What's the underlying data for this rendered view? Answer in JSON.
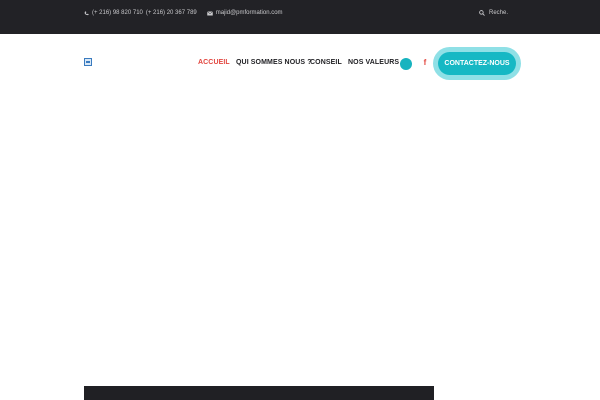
{
  "topbar": {
    "phone_1": "(+ 216) 98 820 710",
    "phone_2": "(+ 216) 20 367 789",
    "email": "majid@pmformation.com",
    "search_placeholder": "Reche.",
    "phone_icon": "phone-icon",
    "email_icon": "envelope-icon",
    "search_icon": "search-icon"
  },
  "nav": {
    "items": [
      {
        "label": "ACCUEIL",
        "active": true
      },
      {
        "label": "QUI SOMMES NOUS ?",
        "active": false
      },
      {
        "label": "CONSEIL",
        "active": false
      },
      {
        "label": "NOS VALEURS",
        "active": false
      }
    ],
    "social": {
      "facebook_glyph": "f",
      "facebook_icon": "facebook-icon",
      "circle_icon": "social-circle-icon"
    },
    "cta_label": "CONTACTEZ-NOUS"
  },
  "colors": {
    "topbar_bg": "#222226",
    "accent_red": "#e2463f",
    "accent_teal": "#16b8c4",
    "nav_text": "#1e1e22"
  }
}
